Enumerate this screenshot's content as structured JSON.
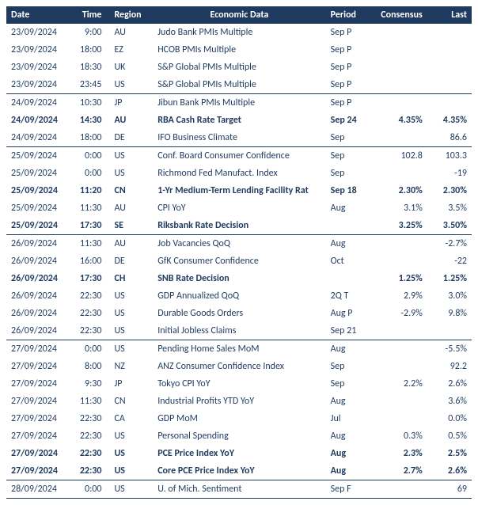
{
  "headers": {
    "date": "Date",
    "time": "Time",
    "region": "Region",
    "econ": "Economic Data",
    "period": "Period",
    "consensus": "Consensus",
    "last": "Last"
  },
  "rows": [
    {
      "date": "23/09/2024",
      "time": "9:00",
      "region": "AU",
      "econ": "Judo Bank PMIs Multiple",
      "period": "Sep P",
      "consensus": "",
      "last": "",
      "bold": false,
      "sep": false
    },
    {
      "date": "23/09/2024",
      "time": "18:00",
      "region": "EZ",
      "econ": "HCOB PMIs Multiple",
      "period": "Sep P",
      "consensus": "",
      "last": "",
      "bold": false,
      "sep": false
    },
    {
      "date": "23/09/2024",
      "time": "18:30",
      "region": "UK",
      "econ": "S&P Global PMIs Multiple",
      "period": "Sep P",
      "consensus": "",
      "last": "",
      "bold": false,
      "sep": false
    },
    {
      "date": "23/09/2024",
      "time": "23:45",
      "region": "US",
      "econ": "S&P Global PMIs Multiple",
      "period": "Sep P",
      "consensus": "",
      "last": "",
      "bold": false,
      "sep": false
    },
    {
      "date": "24/09/2024",
      "time": "10:30",
      "region": "JP",
      "econ": "Jibun Bank PMIs Multiple",
      "period": "Sep P",
      "consensus": "",
      "last": "",
      "bold": false,
      "sep": true
    },
    {
      "date": "24/09/2024",
      "time": "14:30",
      "region": "AU",
      "econ": "RBA Cash Rate Target",
      "period": "Sep 24",
      "consensus": "4.35%",
      "last": "4.35%",
      "bold": true,
      "sep": false
    },
    {
      "date": "24/09/2024",
      "time": "18:00",
      "region": "DE",
      "econ": "IFO Business Climate",
      "period": "Sep",
      "consensus": "",
      "last": "86.6",
      "bold": false,
      "sep": false
    },
    {
      "date": "25/09/2024",
      "time": "0:00",
      "region": "US",
      "econ": "Conf. Board Consumer Confidence",
      "period": "Sep",
      "consensus": "102.8",
      "last": "103.3",
      "bold": false,
      "sep": true
    },
    {
      "date": "25/09/2024",
      "time": "0:00",
      "region": "US",
      "econ": "Richmond Fed Manufact. Index",
      "period": "Sep",
      "consensus": "",
      "last": "-19",
      "bold": false,
      "sep": false
    },
    {
      "date": "25/09/2024",
      "time": "11:20",
      "region": "CN",
      "econ": "1-Yr Medium-Term Lending Facility Rat",
      "period": "Sep 18",
      "consensus": "2.30%",
      "last": "2.30%",
      "bold": true,
      "sep": false
    },
    {
      "date": "25/09/2024",
      "time": "11:30",
      "region": "AU",
      "econ": "CPI YoY",
      "period": "Aug",
      "consensus": "3.1%",
      "last": "3.5%",
      "bold": false,
      "sep": false
    },
    {
      "date": "25/09/2024",
      "time": "17:30",
      "region": "SE",
      "econ": "Riksbank Rate Decision",
      "period": "",
      "consensus": "3.25%",
      "last": "3.50%",
      "bold": true,
      "sep": false
    },
    {
      "date": "26/09/2024",
      "time": "11:30",
      "region": "AU",
      "econ": "Job Vacancies QoQ",
      "period": "Aug",
      "consensus": "",
      "last": "-2.7%",
      "bold": false,
      "sep": true
    },
    {
      "date": "26/09/2024",
      "time": "16:00",
      "region": "DE",
      "econ": "GfK Consumer Confidence",
      "period": "Oct",
      "consensus": "",
      "last": "-22",
      "bold": false,
      "sep": false
    },
    {
      "date": "26/09/2024",
      "time": "17:30",
      "region": "CH",
      "econ": "SNB Rate Decision",
      "period": "",
      "consensus": "1.25%",
      "last": "1.25%",
      "bold": true,
      "sep": false
    },
    {
      "date": "26/09/2024",
      "time": "22:30",
      "region": "US",
      "econ": "GDP Annualized QoQ",
      "period": "2Q T",
      "consensus": "2.9%",
      "last": "3.0%",
      "bold": false,
      "sep": false
    },
    {
      "date": "26/09/2024",
      "time": "22:30",
      "region": "US",
      "econ": "Durable Goods Orders",
      "period": "Aug P",
      "consensus": "-2.9%",
      "last": "9.8%",
      "bold": false,
      "sep": false
    },
    {
      "date": "26/09/2024",
      "time": "22:30",
      "region": "US",
      "econ": "Initial Jobless Claims",
      "period": "Sep 21",
      "consensus": "",
      "last": "",
      "bold": false,
      "sep": false
    },
    {
      "date": "27/09/2024",
      "time": "0:00",
      "region": "US",
      "econ": "Pending Home Sales MoM",
      "period": "Aug",
      "consensus": "",
      "last": "-5.5%",
      "bold": false,
      "sep": true
    },
    {
      "date": "27/09/2024",
      "time": "8:00",
      "region": "NZ",
      "econ": "ANZ Consumer Confidence Index",
      "period": "Sep",
      "consensus": "",
      "last": "92.2",
      "bold": false,
      "sep": false
    },
    {
      "date": "27/09/2024",
      "time": "9:30",
      "region": "JP",
      "econ": "Tokyo CPI YoY",
      "period": "Sep",
      "consensus": "2.2%",
      "last": "2.6%",
      "bold": false,
      "sep": false
    },
    {
      "date": "27/09/2024",
      "time": "11:30",
      "region": "CN",
      "econ": "Industrial Profits YTD YoY",
      "period": "Aug",
      "consensus": "",
      "last": "3.6%",
      "bold": false,
      "sep": false
    },
    {
      "date": "27/09/2024",
      "time": "22:30",
      "region": "CA",
      "econ": "GDP MoM",
      "period": "Jul",
      "consensus": "",
      "last": "0.0%",
      "bold": false,
      "sep": false
    },
    {
      "date": "27/09/2024",
      "time": "22:30",
      "region": "US",
      "econ": "Personal Spending",
      "period": "Aug",
      "consensus": "0.3%",
      "last": "0.5%",
      "bold": false,
      "sep": false
    },
    {
      "date": "27/09/2024",
      "time": "22:30",
      "region": "US",
      "econ": "PCE Price Index YoY",
      "period": "Aug",
      "consensus": "2.3%",
      "last": "2.5%",
      "bold": true,
      "sep": false
    },
    {
      "date": "27/09/2024",
      "time": "22:30",
      "region": "US",
      "econ": "Core PCE Price Index YoY",
      "period": "Aug",
      "consensus": "2.7%",
      "last": "2.6%",
      "bold": true,
      "sep": false
    },
    {
      "date": "28/09/2024",
      "time": "0:00",
      "region": "US",
      "econ": "U. of Mich. Sentiment",
      "period": "Sep F",
      "consensus": "",
      "last": "69",
      "bold": false,
      "sep": true
    }
  ]
}
